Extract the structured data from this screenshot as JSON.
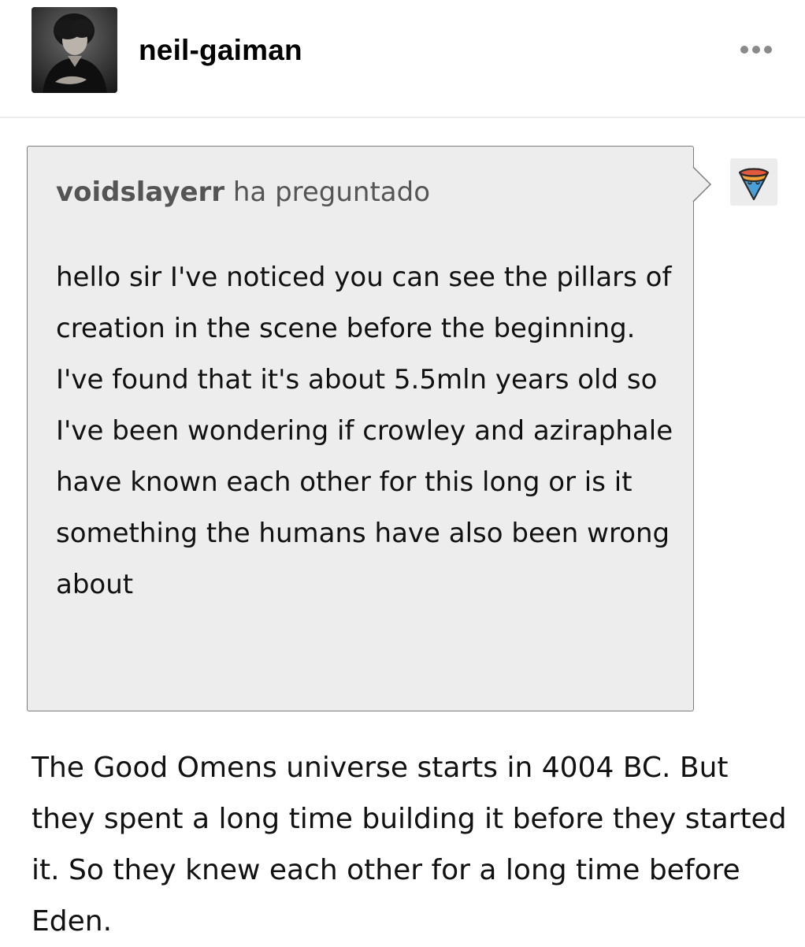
{
  "post": {
    "blog_name": "neil-gaiman",
    "avatar_icon": "blog-avatar-photo",
    "more_icon": "more-options-icon"
  },
  "ask": {
    "asker": "voidslayerr",
    "asked_label": "ha preguntado",
    "asker_avatar_icon": "pizza-slice-avatar-icon",
    "question": "hello sir I've noticed you can see the pillars of creation in the scene before the beginning. I've found that it's about 5.5mln years old so I've been wondering if crowley and aziraphale have known each other for this long or is it something the humans have also been wrong about"
  },
  "answer": {
    "text": "The Good Omens universe starts in 4004 BC. But they spent a long time building it before they started it. So they knew each other for a long time before Eden."
  },
  "colors": {
    "ask_background": "#ededed",
    "ask_border": "#7d7d7d",
    "muted_text": "#555555",
    "body_text": "#111111"
  }
}
